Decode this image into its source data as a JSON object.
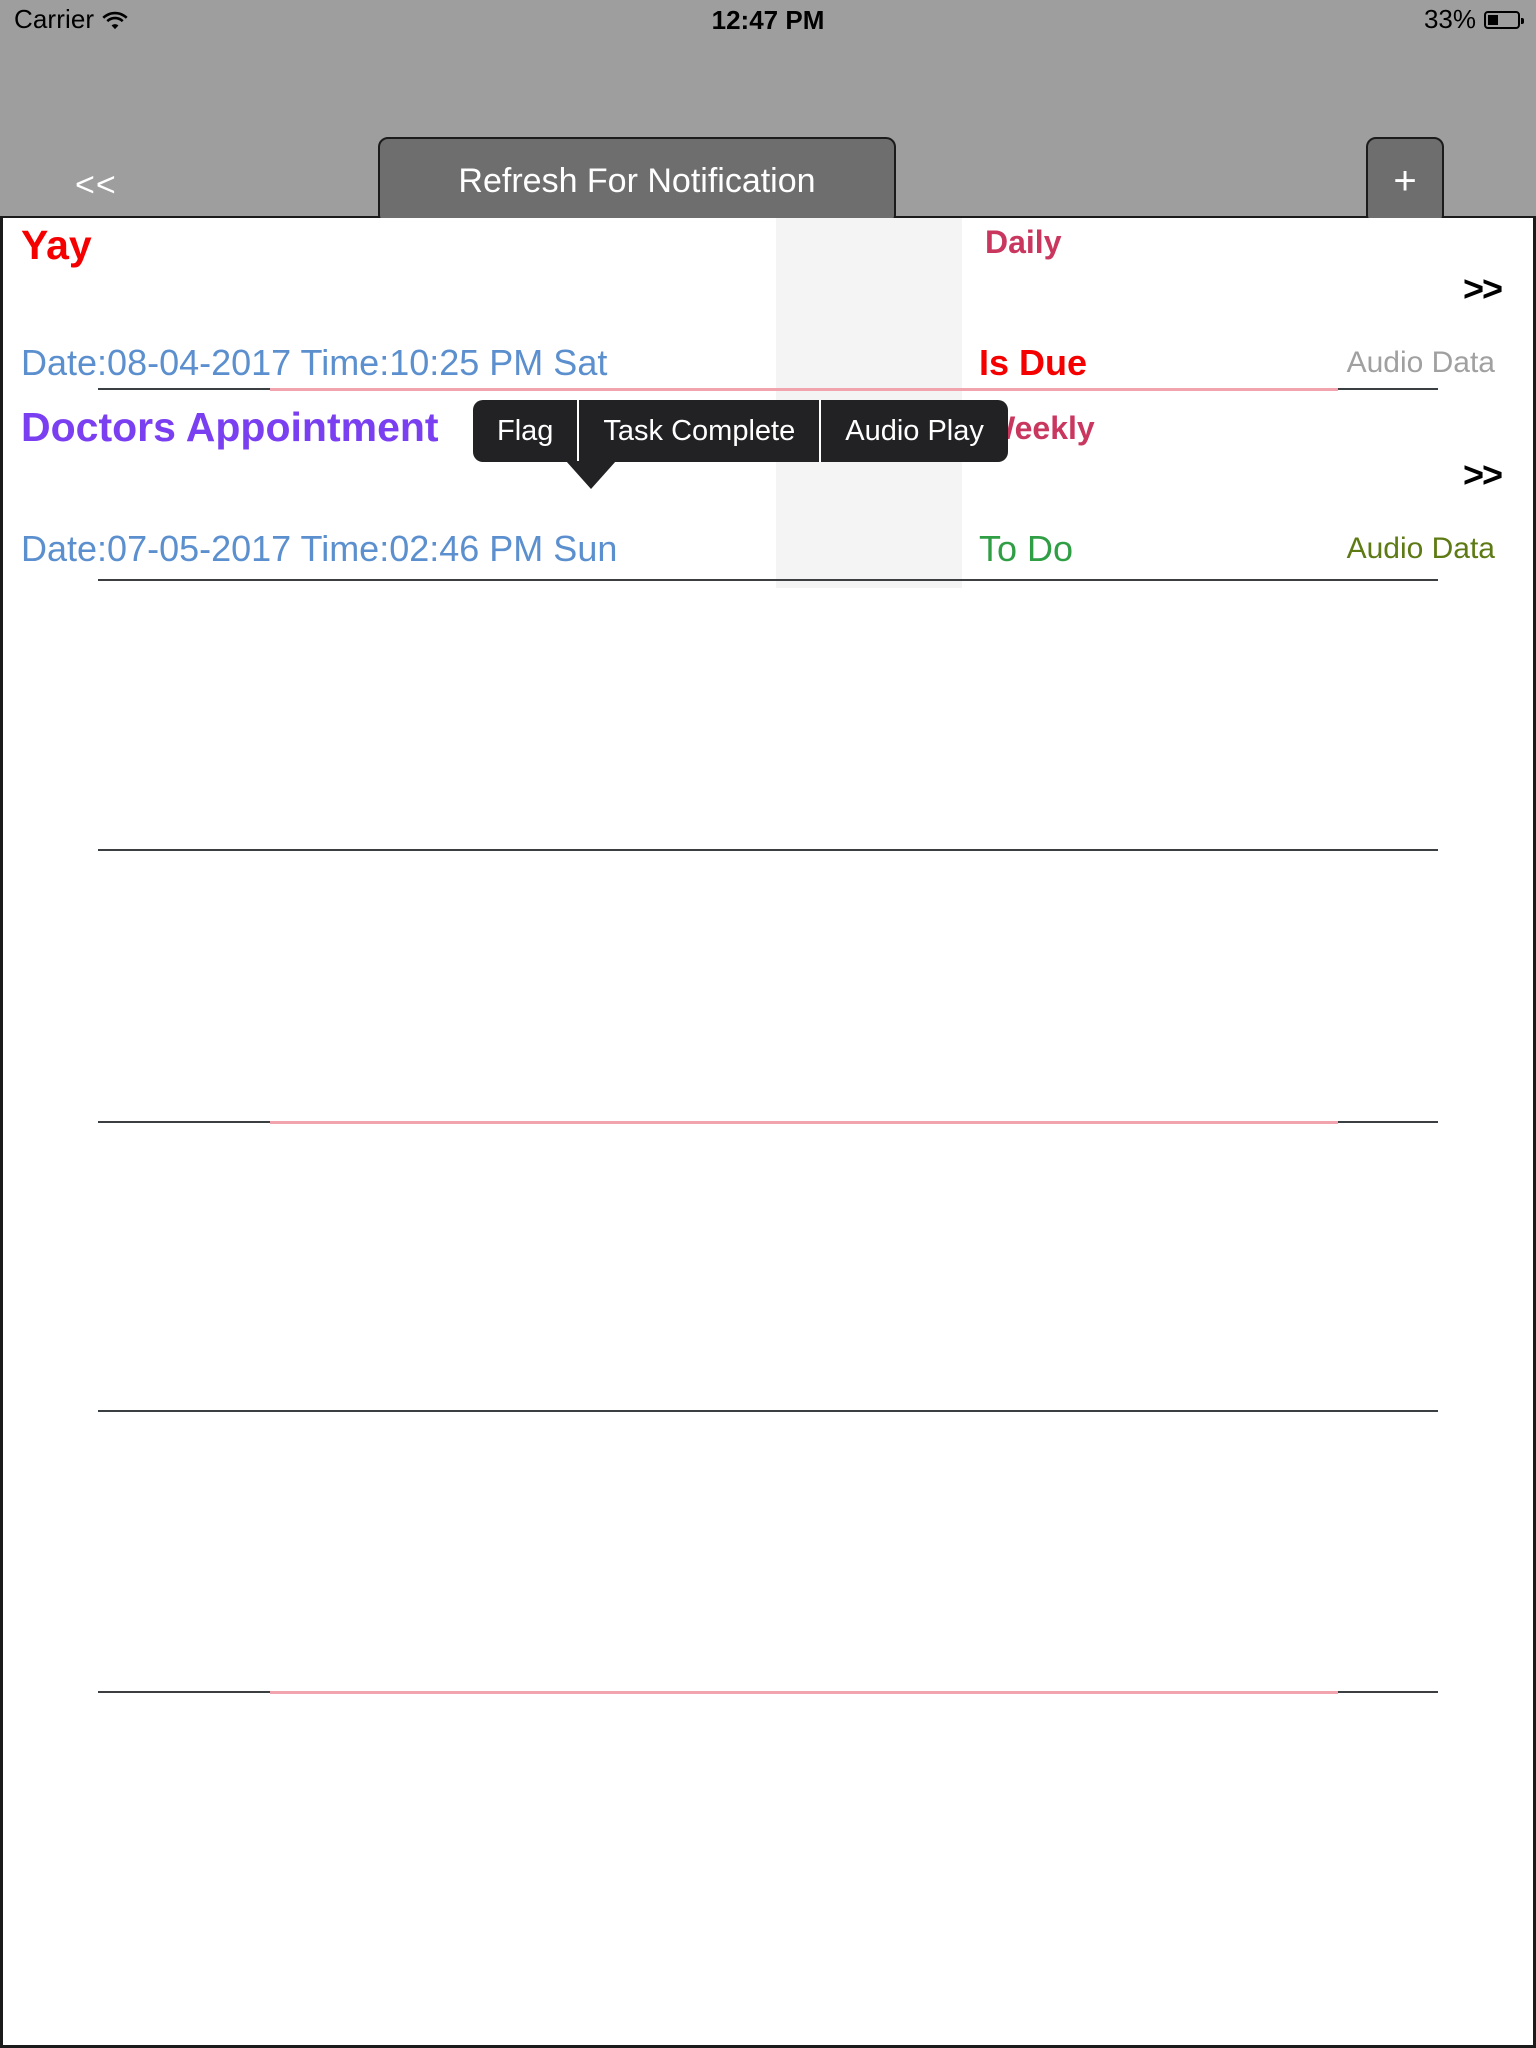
{
  "status_bar": {
    "carrier": "Carrier",
    "wifi_icon": "wifi-icon",
    "time": "12:47 PM",
    "battery_percent": "33%",
    "battery_icon": "battery-icon"
  },
  "nav_bar": {
    "back_label": "<<",
    "refresh_label": "Refresh For Notification",
    "add_label": "+"
  },
  "context_menu": {
    "visible": true,
    "items": [
      {
        "label": "Flag"
      },
      {
        "label": "Task Complete"
      },
      {
        "label": "Audio Play"
      }
    ]
  },
  "colors": {
    "statusbar_bg": "#9e9e9e",
    "navbar_bg": "#9e9e9e",
    "button_bg": "#6e6e6e",
    "menu_bg": "#222224",
    "repeat_text": "#c9365e",
    "date_text": "#5b8fce",
    "separator": "#3b3f42",
    "separator_overdue": "#f1a3ae",
    "thumb_placeholder": "#f4f4f4"
  },
  "list": {
    "rows": [
      {
        "title": "Yay",
        "title_color": "#f40000",
        "repeat": "Daily",
        "chevron": ">>",
        "date": "Date:08-04-2017 Time:10:25 PM Sat",
        "status": "Is Due",
        "status_color": "#f40000",
        "audio": "Audio Data",
        "audio_color": "#a0a0a0",
        "has_thumb": true
      },
      {
        "title": "Doctors Appointment",
        "title_color": "#7b3ff2",
        "repeat": "Weekly",
        "chevron": ">>",
        "date": "Date:07-05-2017 Time:02:46 PM Sun",
        "status": "To Do",
        "status_color": "#2f9e44",
        "audio": "Audio Data",
        "audio_color": "#5d7a14",
        "has_thumb": true
      },
      {
        "title": "",
        "repeat": "",
        "chevron": "",
        "date": "",
        "status": "",
        "audio": "",
        "has_thumb": false
      },
      {
        "title": "",
        "repeat": "",
        "chevron": "",
        "date": "",
        "status": "",
        "audio": "",
        "has_thumb": false
      },
      {
        "title": "",
        "repeat": "",
        "chevron": "",
        "date": "",
        "status": "",
        "audio": "",
        "has_thumb": false
      },
      {
        "title": "",
        "repeat": "",
        "chevron": "",
        "date": "",
        "status": "",
        "audio": "",
        "has_thumb": false
      }
    ]
  }
}
